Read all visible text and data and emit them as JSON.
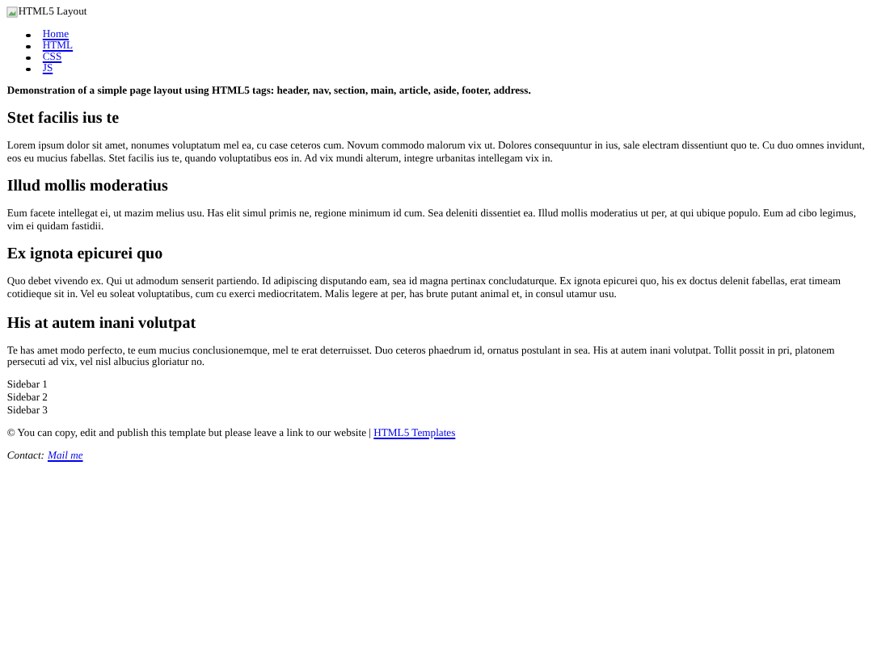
{
  "header": {
    "logo_alt": "HTML5 Layout"
  },
  "nav": {
    "items": [
      {
        "label": "Home"
      },
      {
        "label": "HTML"
      },
      {
        "label": "CSS"
      },
      {
        "label": "JS"
      }
    ]
  },
  "intro": "Demonstration of a simple page layout using HTML5 tags: header, nav, section, main, article, aside, footer, address.",
  "articles": [
    {
      "title": "Stet facilis ius te",
      "body": "Lorem ipsum dolor sit amet, nonumes voluptatum mel ea, cu case ceteros cum. Novum commodo malorum vix ut. Dolores consequuntur in ius, sale electram dissentiunt quo te. Cu duo omnes invidunt, eos eu mucius fabellas. Stet facilis ius te, quando voluptatibus eos in. Ad vix mundi alterum, integre urbanitas intellegam vix in."
    },
    {
      "title": "Illud mollis moderatius",
      "body": "Eum facete intellegat ei, ut mazim melius usu. Has elit simul primis ne, regione minimum id cum. Sea deleniti dissentiet ea. Illud mollis moderatius ut per, at qui ubique populo. Eum ad cibo legimus, vim ei quidam fastidii."
    },
    {
      "title": "Ex ignota epicurei quo",
      "body": "Quo debet vivendo ex. Qui ut admodum senserit partiendo. Id adipiscing disputando eam, sea id magna pertinax concludaturque. Ex ignota epicurei quo, his ex doctus delenit fabellas, erat timeam cotidieque sit in. Vel eu soleat voluptatibus, cum cu exerci mediocritatem. Malis legere at per, has brute putant animal et, in consul utamur usu."
    },
    {
      "title": "His at autem inani volutpat",
      "body": "Te has amet modo perfecto, te eum mucius conclusionemque, mel te erat deterruisset. Duo ceteros phaedrum id, ornatus postulant in sea. His at autem inani volutpat. Tollit possit in pri, platonem persecuti ad vix, vel nisl albucius gloriatur no."
    }
  ],
  "sidebar": [
    "Sidebar 1",
    "Sidebar 2",
    "Sidebar 3"
  ],
  "footer": {
    "text": "© You can copy, edit and publish this template but please leave a link to our website | ",
    "link": "HTML5 Templates"
  },
  "contact": {
    "label": "Contact:",
    "link": "Mail me"
  }
}
